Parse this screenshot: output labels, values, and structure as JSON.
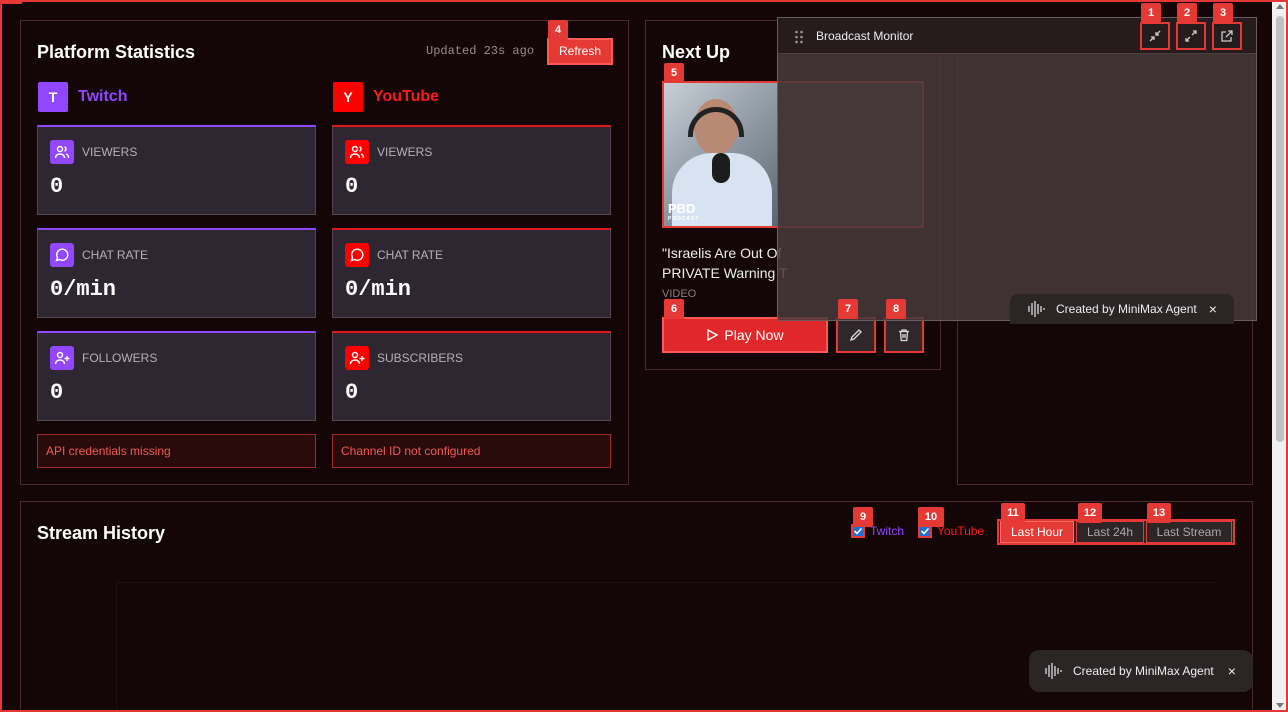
{
  "stats": {
    "title": "Platform Statistics",
    "updated": "Updated 23s ago",
    "refresh_label": "Refresh",
    "twitch": {
      "badge": "T",
      "name": "Twitch",
      "color": "#9147ff",
      "cards": [
        {
          "label": "VIEWERS",
          "value": "0",
          "icon": "users-icon"
        },
        {
          "label": "CHAT RATE",
          "value": "0/min",
          "icon": "chat-icon"
        },
        {
          "label": "FOLLOWERS",
          "value": "0",
          "icon": "user-plus-icon"
        }
      ],
      "error": "API credentials missing"
    },
    "youtube": {
      "badge": "Y",
      "name": "YouTube",
      "color": "#ff0000",
      "cards": [
        {
          "label": "VIEWERS",
          "value": "0",
          "icon": "users-icon"
        },
        {
          "label": "CHAT RATE",
          "value": "0/min",
          "icon": "chat-icon"
        },
        {
          "label": "SUBSCRIBERS",
          "value": "0",
          "icon": "user-plus-icon"
        }
      ],
      "error": "Channel ID not configured"
    }
  },
  "next_up": {
    "title": "Next Up",
    "video_title_line1": "\"Israelis Are Out Of",
    "video_title_line2": "PRIVATE Warning T",
    "type": "VIDEO",
    "thumb_text": "PBD",
    "thumb_sub": "PODCAST",
    "play_label": "Play Now"
  },
  "monitor": {
    "title": "Broadcast Monitor",
    "watermark": "Created by MiniMax Agent",
    "close": "×"
  },
  "history": {
    "title": "Stream History",
    "twitch_label": "Twitch",
    "youtube_label": "YouTube",
    "ranges": [
      "Last Hour",
      "Last 24h",
      "Last Stream"
    ]
  },
  "toast": {
    "text": "Created by MiniMax Agent",
    "close": "×"
  },
  "marks": [
    "1",
    "2",
    "3",
    "4",
    "5",
    "6",
    "7",
    "8",
    "9",
    "10",
    "11",
    "12",
    "13"
  ],
  "colors": {
    "accent": "#e53935",
    "twitch": "#9147ff",
    "youtube": "#ff0000"
  }
}
